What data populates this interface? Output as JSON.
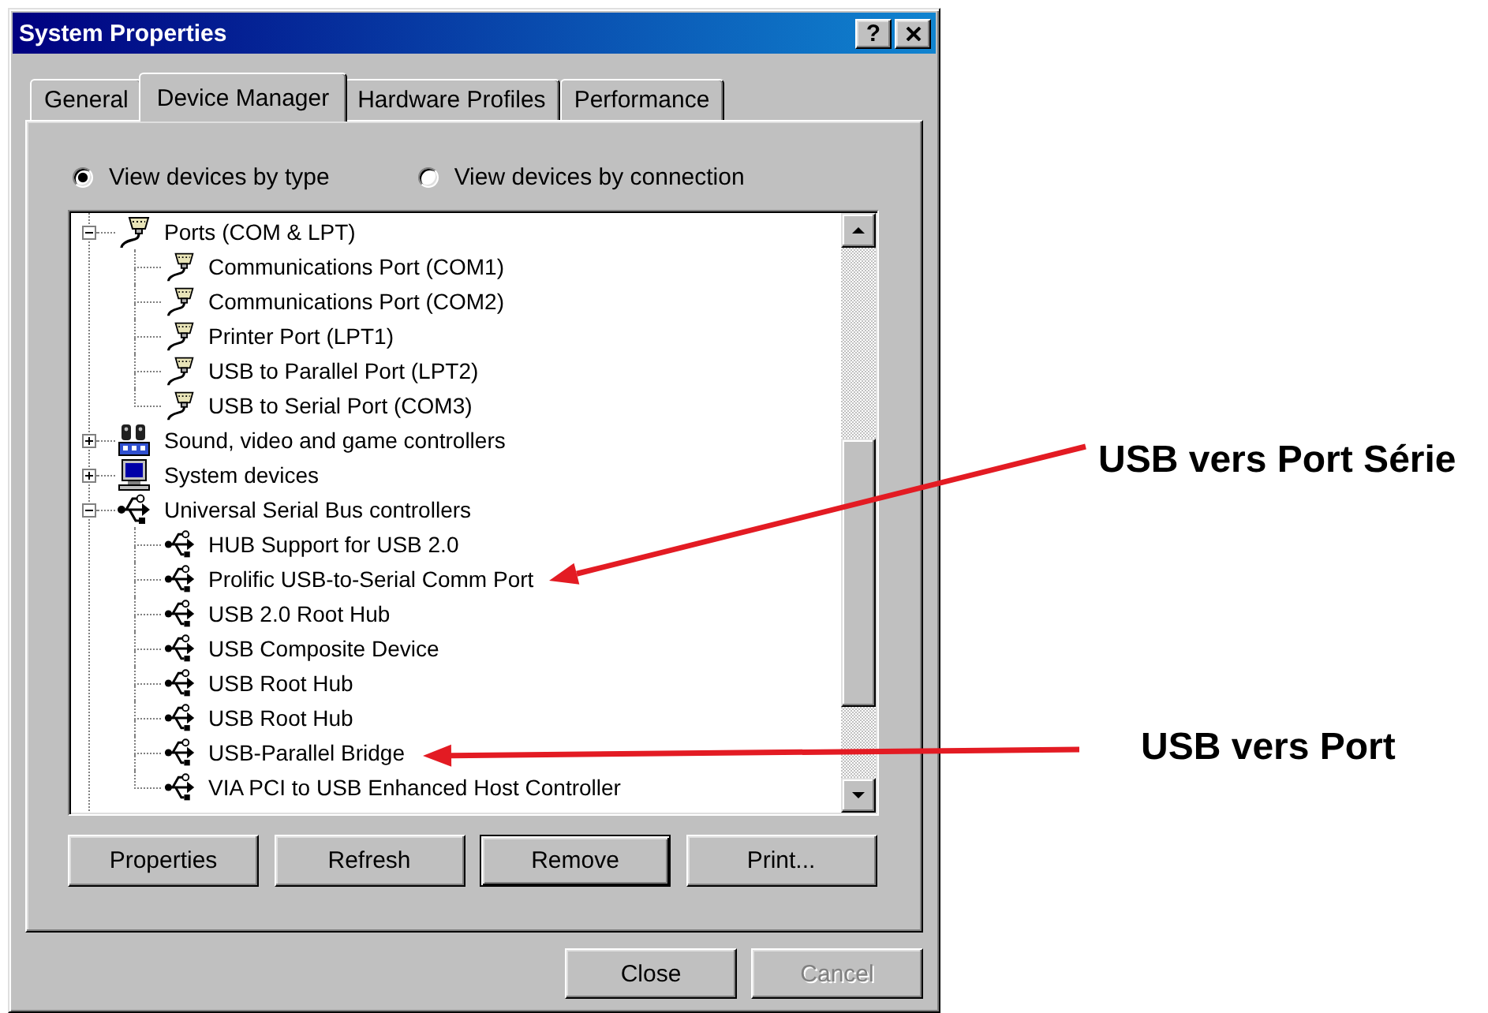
{
  "window": {
    "title": "System Properties",
    "help_button": "?"
  },
  "tabs": [
    {
      "label": "General",
      "selected": false
    },
    {
      "label": "Device Manager",
      "selected": true
    },
    {
      "label": "Hardware Profiles",
      "selected": false
    },
    {
      "label": "Performance",
      "selected": false
    }
  ],
  "view_options": [
    {
      "label": "View devices by type",
      "selected": true
    },
    {
      "label": "View devices by connection",
      "selected": false
    }
  ],
  "device_tree": [
    {
      "label": "Ports (COM & LPT)",
      "kind": "port",
      "expanded": true,
      "children": [
        {
          "label": "Communications Port (COM1)",
          "kind": "port"
        },
        {
          "label": "Communications Port (COM2)",
          "kind": "port"
        },
        {
          "label": "Printer Port (LPT1)",
          "kind": "port"
        },
        {
          "label": "USB to Parallel Port (LPT2)",
          "kind": "port"
        },
        {
          "label": "USB to Serial Port (COM3)",
          "kind": "port"
        }
      ]
    },
    {
      "label": "Sound, video and game controllers",
      "kind": "sound",
      "expanded": false
    },
    {
      "label": "System devices",
      "kind": "system",
      "expanded": false
    },
    {
      "label": "Universal Serial Bus controllers",
      "kind": "usb",
      "expanded": true,
      "children": [
        {
          "label": "HUB Support for USB 2.0",
          "kind": "usb"
        },
        {
          "label": "Prolific USB-to-Serial Comm Port",
          "kind": "usb"
        },
        {
          "label": "USB 2.0 Root Hub",
          "kind": "usb"
        },
        {
          "label": "USB Composite Device",
          "kind": "usb"
        },
        {
          "label": "USB Root Hub",
          "kind": "usb"
        },
        {
          "label": "USB Root Hub",
          "kind": "usb"
        },
        {
          "label": "USB-Parallel Bridge",
          "kind": "usb"
        },
        {
          "label": "VIA PCI to USB Enhanced Host Controller",
          "kind": "usb"
        }
      ]
    }
  ],
  "panel_buttons": [
    {
      "label": "Properties",
      "default": false
    },
    {
      "label": "Refresh",
      "default": false
    },
    {
      "label": "Remove",
      "default": true
    },
    {
      "label": "Print...",
      "default": false
    }
  ],
  "dialog_buttons": [
    {
      "label": "Close",
      "disabled": false
    },
    {
      "label": "Cancel",
      "disabled": true
    }
  ],
  "annotations": [
    {
      "text": "USB vers Port Série"
    },
    {
      "text": "USB vers Port"
    }
  ]
}
